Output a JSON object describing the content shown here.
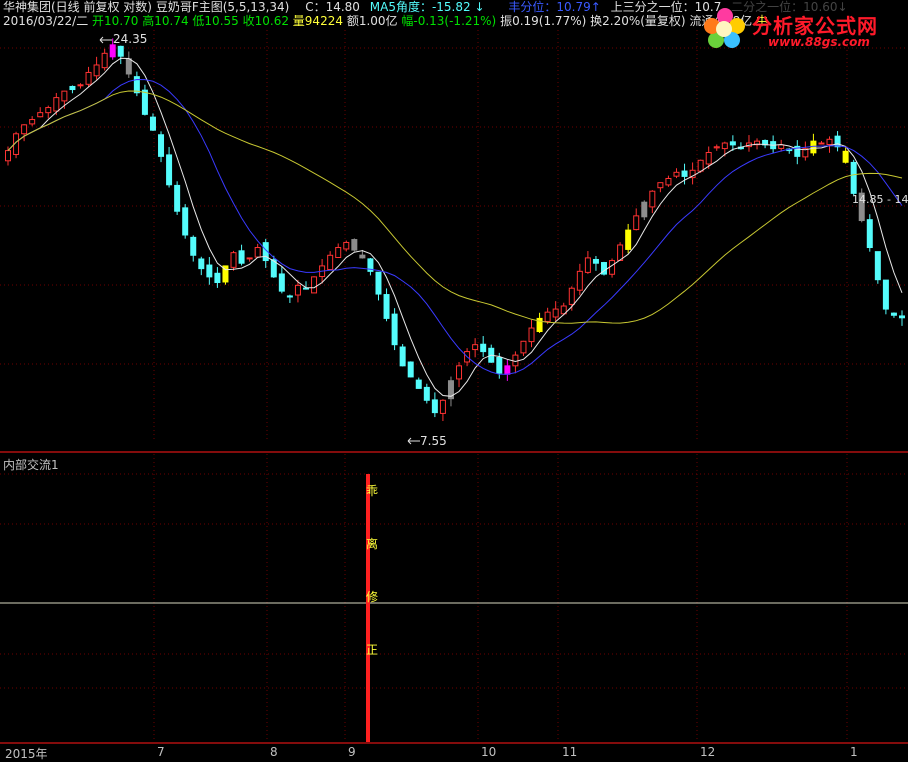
{
  "header": {
    "stock_title": "华神集团(日线 前复权 对数)",
    "indicator": "豆奶哥F主图(5,5,13,34)",
    "c_label": "C：14.80",
    "ma5_angle": "MA5角度：-15.82",
    "down_arrow": "↓",
    "split_label": "丰分位：10.79↑",
    "third_label": "上三分之一位：10.7",
    "faded_text": "二分之一位：10.60↓",
    "date_day": "2016/03/22/二",
    "open": "开10.70",
    "high": "高10.74",
    "low": "低10.55",
    "close": "收10.62",
    "volume": "量94224",
    "amount": "额1.00亿",
    "change": "幅-0.13(-1.21%)",
    "amplitude": "振0.19(1.77%)",
    "turnover": "换2.20%(量复权)",
    "float_shares": "流通4.28亿",
    "tag_char": "中"
  },
  "logo": {
    "name": "分析家公式网",
    "url": "www.88gs.com"
  },
  "annotations": {
    "high_label": "24.35",
    "low_label": "7.55",
    "right_label": "14.85 - 14"
  },
  "subchart": {
    "title": "内部交流1",
    "vertical_chars": [
      "乖",
      "离",
      "修",
      "正"
    ]
  },
  "x_axis_labels": [
    "2015年",
    "7",
    "8",
    "9",
    "10",
    "11",
    "12",
    "1"
  ],
  "colors": {
    "background": "#000000",
    "up": "#ff3232",
    "down": "#54fcfc",
    "grid": "#6e0000",
    "ma_white": "#e8e8e8",
    "ma_blue": "#3a3aff",
    "ma_yellow": "#c8c832",
    "highlight_yellow": "#ffff00",
    "highlight_magenta": "#ff00ff",
    "highlight_gray": "#8c8c8c",
    "subchart_bar": "#ff2020"
  },
  "chart_data": {
    "type": "candlestick",
    "scale": "log",
    "price_range": [
      7.55,
      24.35
    ],
    "close_series": [
      17.5,
      18.4,
      18.9,
      19.2,
      19.6,
      19.9,
      20.5,
      20.9,
      21.0,
      21.3,
      22.1,
      22.6,
      23.4,
      24.0,
      23.2,
      22.0,
      20.8,
      19.5,
      18.6,
      17.2,
      15.8,
      14.6,
      13.6,
      12.8,
      12.3,
      12.0,
      11.8,
      12.4,
      12.9,
      12.5,
      12.7,
      13.1,
      12.6,
      12.0,
      11.5,
      11.3,
      11.7,
      11.6,
      12.0,
      12.4,
      12.8,
      13.1,
      13.3,
      13.0,
      12.7,
      12.2,
      11.4,
      10.6,
      9.8,
      9.2,
      8.9,
      8.6,
      8.3,
      8.0,
      8.3,
      8.8,
      9.2,
      9.6,
      9.8,
      9.6,
      9.3,
      9.0,
      9.2,
      9.5,
      9.9,
      10.3,
      10.6,
      10.8,
      10.9,
      11.0,
      11.6,
      12.2,
      12.7,
      12.5,
      12.1,
      12.6,
      13.2,
      13.8,
      14.4,
      15.0,
      15.5,
      15.9,
      16.1,
      16.4,
      16.2,
      16.5,
      17.0,
      17.4,
      17.7,
      17.9,
      17.8,
      17.6,
      17.9,
      18.0,
      17.8,
      17.6,
      17.8,
      17.5,
      17.2,
      17.6,
      18.0,
      17.9,
      18.1,
      17.7,
      16.9,
      15.4,
      14.2,
      13.1,
      11.9,
      10.9,
      10.7,
      10.62
    ],
    "ma_periods": [
      5,
      13,
      34
    ],
    "subchart_value_label": "乖离修正"
  }
}
